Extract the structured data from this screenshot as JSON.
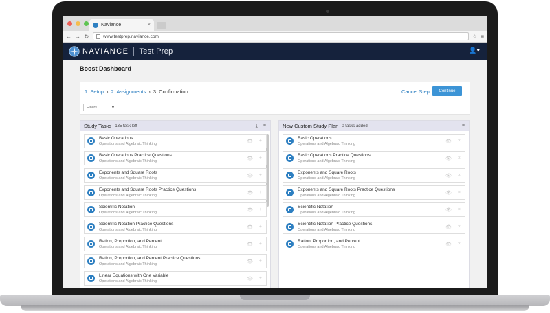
{
  "browser": {
    "tab_title": "Naviance",
    "tab_close": "×",
    "url": "www.testprep.naviance.com",
    "back": "←",
    "forward": "→",
    "reload": "↻",
    "star": "☆",
    "menu": "≡"
  },
  "app": {
    "brand": "NAVIANCE",
    "product": "Test Prep",
    "user_menu": "👤▾"
  },
  "page": {
    "title": "Boost Dashboard",
    "steps": [
      {
        "label": "1. Setup"
      },
      {
        "label": "2. Assignments"
      },
      {
        "label": "3. Confirmation"
      }
    ],
    "step_sep": "›",
    "cancel": "Cancel Step",
    "continue": "Continue",
    "filters": "Filters",
    "filters_caret": "▼"
  },
  "study_tasks": {
    "title": "Study Tasks",
    "count": "135 task left",
    "download_icon": "⤓",
    "menu_icon": "≡",
    "items": [
      {
        "name": "Basic Operations",
        "sub": "Operations and Algebraic Thinking"
      },
      {
        "name": "Basic Operations Practice Questions",
        "sub": "Operations and Algebraic Thinking"
      },
      {
        "name": "Exponents and Square Roots",
        "sub": "Operations and Algebraic Thinking"
      },
      {
        "name": "Exponents and Square Roots Practice Questions",
        "sub": "Operations and Algebraic Thinking"
      },
      {
        "name": "Scientific Notation",
        "sub": "Operations and Algebraic Thinking"
      },
      {
        "name": "Scientific Notation Practice Questions",
        "sub": "Operations and Algebraic Thinking"
      },
      {
        "name": "Ration, Proportion, and Percent",
        "sub": "Operations and Algebraic Thinking"
      },
      {
        "name": "Ration, Proportion, and Percent Practice Questions",
        "sub": "Operations and Algebraic Thinking"
      },
      {
        "name": "Linear Equations with One Variable",
        "sub": "Operations and Algebraic Thinking"
      }
    ]
  },
  "custom_plan": {
    "title": "New Custom Study Plan",
    "count": "0 tasks added",
    "menu_icon": "≡",
    "items": [
      {
        "name": "Basic Operations",
        "sub": "Operations and Algebraic Thinking"
      },
      {
        "name": "Basic Operations Practice Questions",
        "sub": "Operations and Algebraic Thinking"
      },
      {
        "name": "Exponents and Square Roots",
        "sub": "Operations and Algebraic Thinking"
      },
      {
        "name": "Exponents and Square Roots Practice Questions",
        "sub": "Operations and Algebraic Thinking"
      },
      {
        "name": "Scientific Notation",
        "sub": "Operations and Algebraic Thinking"
      },
      {
        "name": "Scientific Notation Practice Questions",
        "sub": "Operations and Algebraic Thinking"
      },
      {
        "name": "Ration, Proportion, and Percent",
        "sub": "Operations and Algebraic Thinking"
      }
    ]
  },
  "icons": {
    "view": "👁",
    "add": "+",
    "remove": "×"
  },
  "colors": {
    "brand_navy": "#15223c",
    "accent_blue": "#2d7fc1",
    "button_blue": "#3c94d6",
    "panel_header": "#e3e3ef"
  }
}
